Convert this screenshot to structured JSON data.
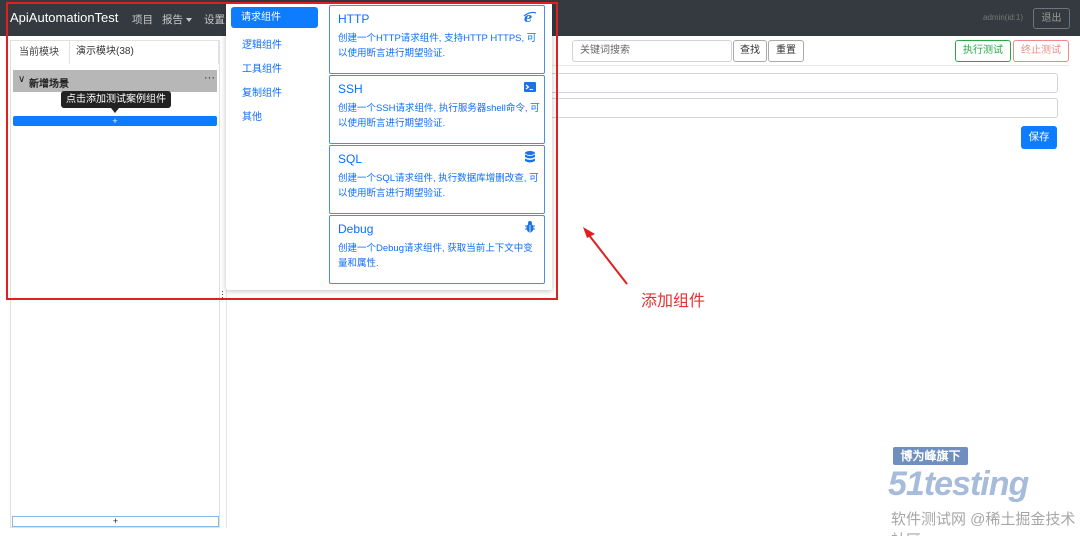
{
  "app": {
    "title": "ApiAutomationTest"
  },
  "nav": {
    "items": [
      "项目",
      "报告",
      "设置"
    ],
    "user_label": "admin(id:1)",
    "logout_label": "退出"
  },
  "left": {
    "tab_current": "当前模块",
    "tab_demo": "演示模块(38)",
    "scene_title": "新增场景",
    "scene_more": "···",
    "tooltip": "点击添加测试案例组件",
    "add_label": "+",
    "add_bottom_label": "+"
  },
  "toolbar": {
    "search_placeholder": "关键词搜索",
    "find_label": "查找",
    "reset_label": "重置",
    "run_label": "执行测试",
    "stop_label": "终止测试",
    "save_label": "保存"
  },
  "component_menu": {
    "categories": [
      "请求组件",
      "逻辑组件",
      "工具组件",
      "复制组件",
      "其他"
    ],
    "active_category": "请求组件",
    "cards": [
      {
        "title": "HTTP",
        "desc": "创建一个HTTP请求组件, 支持HTTP HTTPS, 可以使用断言进行期望验证.",
        "icon": "ie-icon"
      },
      {
        "title": "SSH",
        "desc": "创建一个SSH请求组件, 执行服务器shell命令, 可以使用断言进行期望验证.",
        "icon": "terminal-icon"
      },
      {
        "title": "SQL",
        "desc": "创建一个SQL请求组件, 执行数据库增删改查, 可以使用断言进行期望验证.",
        "icon": "database-icon"
      },
      {
        "title": "Debug",
        "desc": "创建一个Debug请求组件, 获取当前上下文中变量和属性.",
        "icon": "bug-icon"
      }
    ]
  },
  "annotation": {
    "text": "添加组件",
    "color": "#e02020"
  },
  "watermark": {
    "banner": "博为峰旗下",
    "logo": "51testing",
    "footer": "软件测试网 @稀土掘金技术社区"
  },
  "colors": {
    "primary": "#0d7cff",
    "success": "#28a745",
    "danger": "#dc3545",
    "navbar": "#343a40"
  }
}
